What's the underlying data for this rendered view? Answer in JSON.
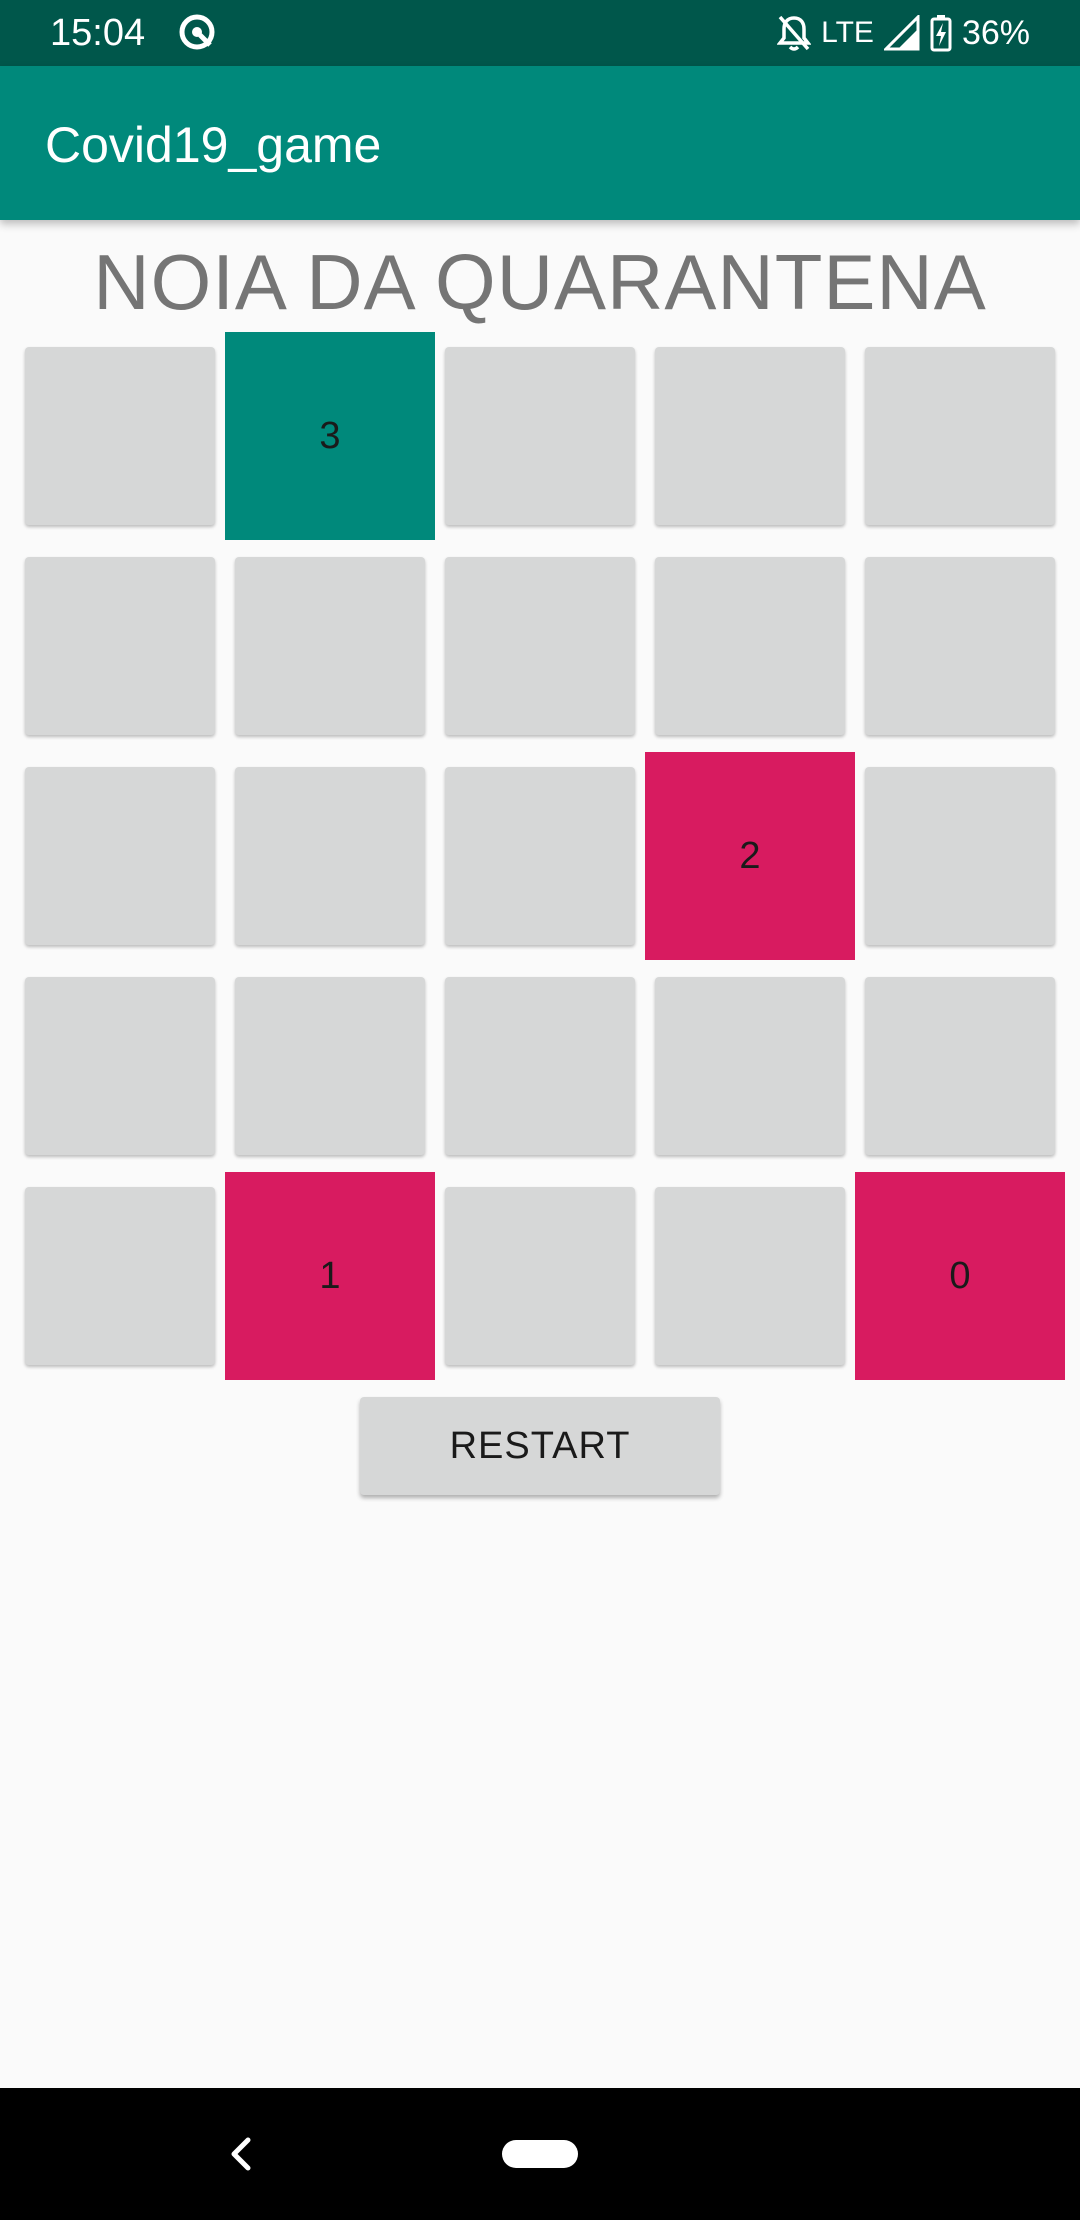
{
  "status_bar": {
    "time": "15:04",
    "network": "LTE",
    "battery": "36%",
    "icons": [
      "app-notification-icon",
      "notifications-off-icon",
      "signal-icon",
      "battery-charging-icon"
    ]
  },
  "app_bar": {
    "title": "Covid19_game",
    "color": "#00897b"
  },
  "game": {
    "title": "NOIA DA QUARANTENA",
    "rows": 5,
    "cols": 5,
    "cells": [
      [
        "",
        "3",
        "",
        "",
        ""
      ],
      [
        "",
        "",
        "",
        "",
        ""
      ],
      [
        "",
        "",
        "",
        "2",
        ""
      ],
      [
        "",
        "",
        "",
        "",
        ""
      ],
      [
        "",
        "1",
        "",
        "",
        "0"
      ]
    ],
    "cell_colors": [
      [
        "#d6d7d7",
        "#00897b",
        "#d6d7d7",
        "#d6d7d7",
        "#d6d7d7"
      ],
      [
        "#d6d7d7",
        "#d6d7d7",
        "#d6d7d7",
        "#d6d7d7",
        "#d6d7d7"
      ],
      [
        "#d6d7d7",
        "#d6d7d7",
        "#d6d7d7",
        "#d81b60",
        "#d6d7d7"
      ],
      [
        "#d6d7d7",
        "#d6d7d7",
        "#d6d7d7",
        "#d6d7d7",
        "#d6d7d7"
      ],
      [
        "#d6d7d7",
        "#d81b60",
        "#d6d7d7",
        "#d6d7d7",
        "#d81b60"
      ]
    ],
    "restart_label": "RESTART"
  },
  "colors": {
    "status_bar": "#00574b",
    "primary": "#00897b",
    "accent": "#d81b60",
    "cell_default": "#d6d7d7"
  },
  "nav_bar": {
    "icons": [
      "back-icon",
      "home-pill-icon"
    ]
  }
}
